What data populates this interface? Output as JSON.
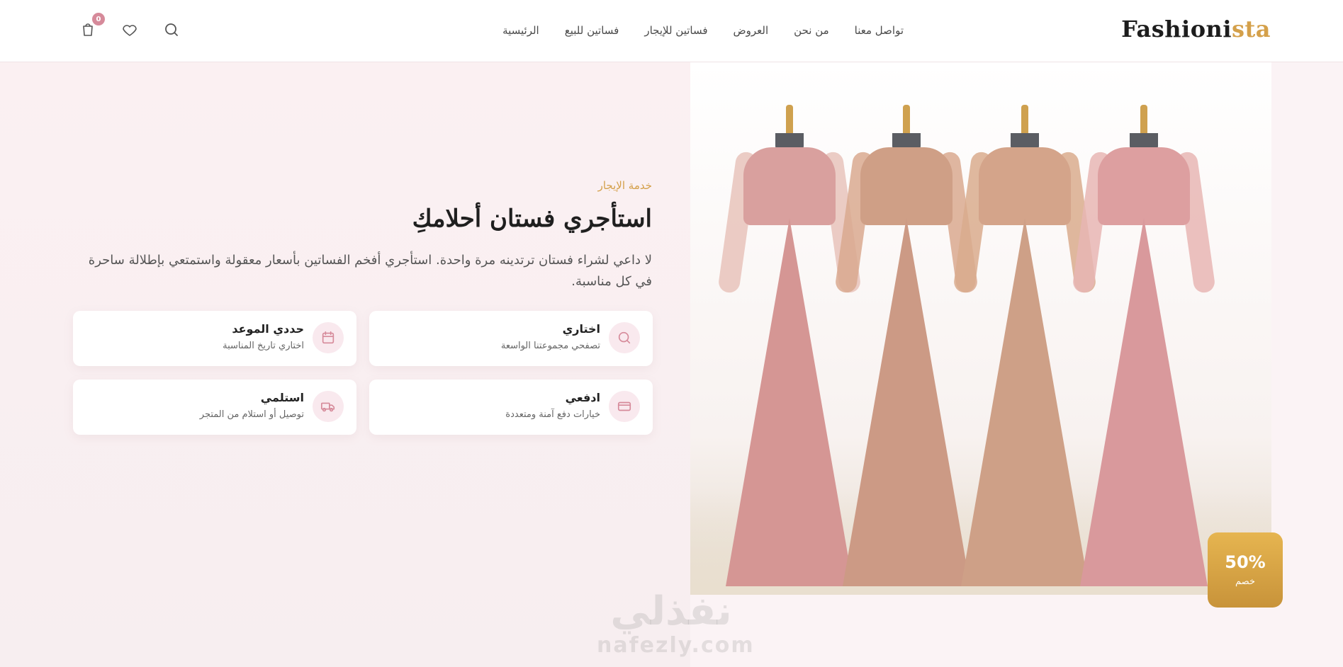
{
  "header": {
    "logo_main": "Fashioni",
    "logo_accent": "sta",
    "nav": [
      "الرئيسية",
      "فساتين للبيع",
      "فساتين للإيجار",
      "العروض",
      "من نحن",
      "تواصل معنا"
    ],
    "cart_count": "0",
    "icons": [
      "search-icon",
      "heart-icon",
      "cart-icon"
    ]
  },
  "hero": {
    "kicker": "خدمة الإيجار",
    "title": "استأجري فستان أحلامكِ",
    "lead": "لا داعي لشراء فستان ترتدينه مرة واحدة. استأجري أفخم الفساتين بأسعار معقولة واستمتعي بإطلالة ساحرة في كل مناسبة."
  },
  "steps": [
    {
      "title": "اختاري",
      "desc": "تصفحي مجموعتنا الواسعة",
      "icon": "search-icon"
    },
    {
      "title": "حددي الموعد",
      "desc": "اختاري تاريخ المناسبة",
      "icon": "calendar-icon"
    },
    {
      "title": "ادفعي",
      "desc": "خيارات دفع آمنة ومتعددة",
      "icon": "credit-card-icon"
    },
    {
      "title": "استلمي",
      "desc": "توصيل أو استلام من المتجر",
      "icon": "truck-icon"
    }
  ],
  "badge": {
    "percent": "50%",
    "label": "خصم"
  },
  "watermark": {
    "arabic": "نفذلي",
    "latin": "nafezly.com"
  },
  "colors": {
    "accent": "#d4a04a",
    "pink": "#d68a9a",
    "background": "#fbf3f5"
  }
}
